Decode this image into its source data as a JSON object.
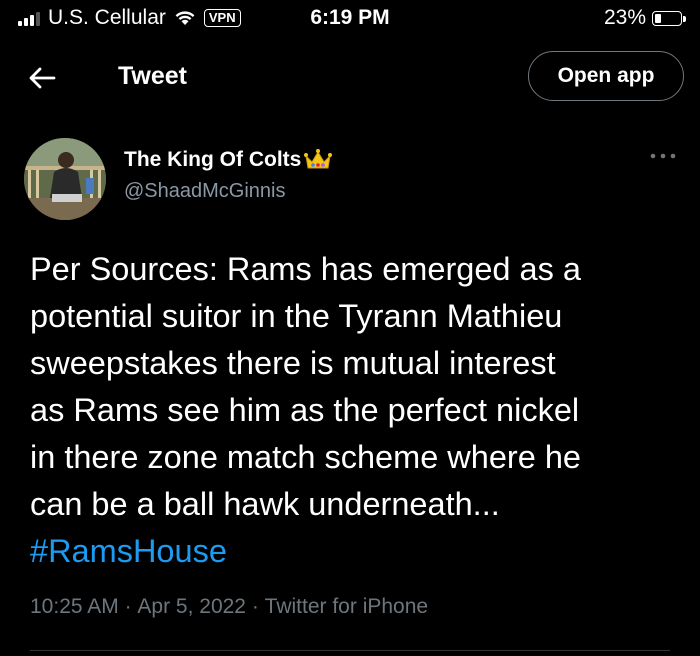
{
  "status_bar": {
    "carrier": "U.S. Cellular",
    "vpn": "VPN",
    "time": "6:19 PM",
    "battery_percent_text": "23%",
    "battery_level": 0.23
  },
  "header": {
    "title": "Tweet",
    "open_app_label": "Open app"
  },
  "tweet": {
    "author_name": "The King Of Colts",
    "author_handle": "@ShaadMcGinnis",
    "text_lines": [
      "Per Sources: Rams has emerged as a",
      "potential suitor in the Tyrann Mathieu",
      "sweepstakes there is mutual interest",
      "as Rams see him as the perfect nickel",
      "in there zone match scheme where he",
      "can be a ball hawk underneath..."
    ],
    "hashtag": "#RamsHouse",
    "time": "10:25 AM",
    "date": "Apr 5, 2022",
    "source": "Twitter for iPhone",
    "separator": " · "
  },
  "colors": {
    "background": "#000000",
    "link": "#1d9bf0",
    "muted": "#6e767d",
    "handle": "#8b98a5"
  },
  "icons": [
    "back-arrow-icon",
    "wifi-icon",
    "battery-icon",
    "crown-icon",
    "more-icon",
    "signal-icon"
  ]
}
